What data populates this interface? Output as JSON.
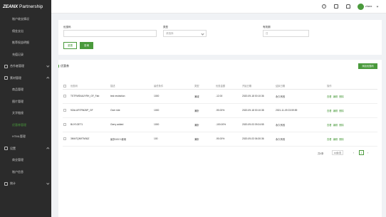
{
  "brand": {
    "logo": "ZEANX",
    "title": "Partnership"
  },
  "sidebar": {
    "items": [
      {
        "label": "账户收支情况",
        "type": "sub"
      },
      {
        "label": "佣金支出",
        "type": "sub"
      },
      {
        "label": "推荐权益明细",
        "type": "sub"
      },
      {
        "label": "充值记录",
        "type": "sub"
      },
      {
        "label": "合作者管理",
        "type": "group",
        "open": false
      },
      {
        "label": "素材管理",
        "type": "group",
        "open": true
      },
      {
        "label": "商品管理",
        "type": "sub"
      },
      {
        "label": "图片管理",
        "type": "sub"
      },
      {
        "label": "文字链接",
        "type": "sub"
      },
      {
        "label": "优惠券管理",
        "type": "sub",
        "active": true
      },
      {
        "label": "HTML管理",
        "type": "sub"
      },
      {
        "label": "设置",
        "type": "group",
        "open": true
      },
      {
        "label": "商业管理",
        "type": "sub"
      },
      {
        "label": "账户信息",
        "type": "sub"
      },
      {
        "label": "统计",
        "type": "group",
        "open": false
      }
    ]
  },
  "topbar": {
    "icons": [
      "help-icon",
      "message-icon",
      "bell-icon"
    ],
    "username": "zhanx"
  },
  "filter": {
    "code_label": "优惠码",
    "code_placeholder": "",
    "type_label": "类型",
    "type_placeholder": "请选择",
    "validity_label": "有效期",
    "validity_placeholder": "日",
    "reset_label": "重置",
    "search_label": "查询"
  },
  "list": {
    "title": "优惠券",
    "add_label": "添加优惠码",
    "columns": [
      "优惠码",
      "描述",
      "最低条件",
      "类型",
      "优惠金额",
      "开始日期",
      "结束日期",
      "操作"
    ],
    "rows": [
      {
        "code": "TSTFMSNAJYRH_GF_Fab",
        "desc": "test restriction",
        "min": "1000",
        "type": "满减",
        "amount": "-12.00",
        "start": "2020-09-18 00:10:36",
        "end": "永久有效"
      },
      {
        "code": "9ZALUR7RNZ6P_GF",
        "desc": "Over ride",
        "min": "1000",
        "type": "满折",
        "amount": "-90.00%",
        "start": "2020-09-18 00:10:38",
        "end": "2021-11-09 23:59:59"
      },
      {
        "code": "BUY1GET1",
        "desc": "Gerry added",
        "min": "1000",
        "type": "满折",
        "amount": "-100.00%",
        "start": "2020-09-03 09:24:55",
        "end": "永久有效"
      },
      {
        "code": "3NW7QN9TNS6Z",
        "desc": "最多100人使用",
        "min": "100",
        "type": "满折",
        "amount": "-90.00%",
        "start": "2020-09-03 06:30:36",
        "end": "永久有效"
      }
    ],
    "actions": [
      "查看",
      "编辑",
      "删除"
    ]
  },
  "pager": {
    "total": "共4条",
    "size": "10条/页",
    "current": "1"
  },
  "colors": {
    "primary": "#4a9a3c",
    "sidebar_bg": "#2b2b2b"
  }
}
